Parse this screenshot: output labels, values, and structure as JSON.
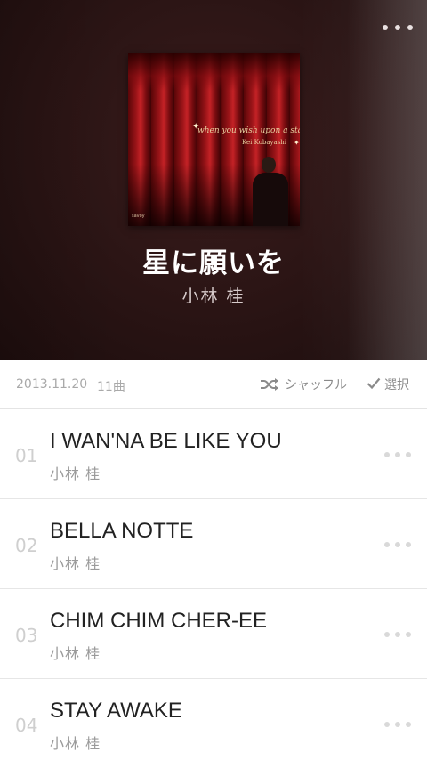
{
  "album": {
    "title": "星に願いを",
    "artist": "小林 桂",
    "cover": {
      "title_text": "when you wish upon a star",
      "artist_text": "Kei Kobayashi",
      "label_text": "savoy",
      "accent_color": "#c42226"
    }
  },
  "info": {
    "date": "2013.11.20",
    "count": "11曲",
    "shuffle_label": "シャッフル",
    "select_label": "選択"
  },
  "tracks": [
    {
      "num": "01",
      "title": "I WAN'NA BE LIKE YOU",
      "artist": "小林 桂"
    },
    {
      "num": "02",
      "title": "BELLA NOTTE",
      "artist": "小林 桂"
    },
    {
      "num": "03",
      "title": "CHIM CHIM CHER-EE",
      "artist": "小林 桂"
    },
    {
      "num": "04",
      "title": "STAY AWAKE",
      "artist": "小林 桂"
    }
  ],
  "icons": {
    "more": "more-dots-icon",
    "shuffle": "shuffle-icon",
    "select": "checkmark-icon"
  },
  "colors": {
    "header_bg": "#2a1414",
    "title_text": "#ffffff",
    "track_title": "#222222",
    "muted_text": "#9a9a9a"
  }
}
